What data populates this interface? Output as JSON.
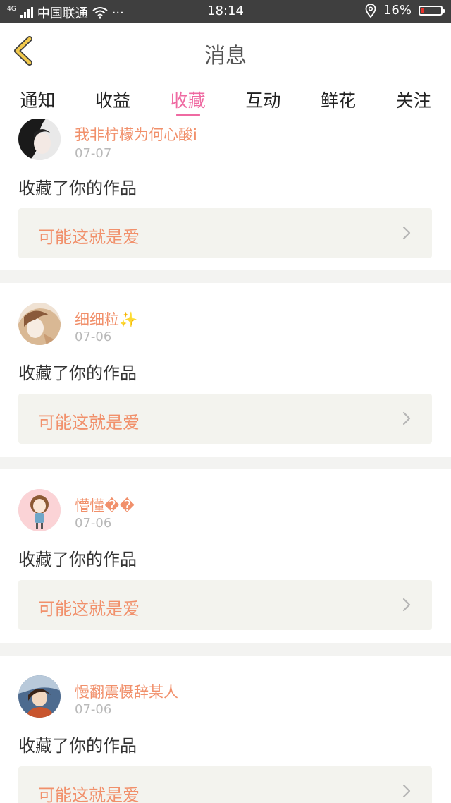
{
  "status_bar": {
    "network": "4G",
    "carrier": "中国联通",
    "dots": "···",
    "time": "18:14",
    "battery": "16%",
    "battery_level": 0.16
  },
  "header": {
    "title": "消息"
  },
  "tabs": [
    {
      "label": "通知"
    },
    {
      "label": "收益"
    },
    {
      "label": "收藏",
      "active": true
    },
    {
      "label": "互动"
    },
    {
      "label": "鲜花"
    },
    {
      "label": "关注"
    }
  ],
  "items": [
    {
      "user": "我非柠檬为何心酸i",
      "date": "07-07",
      "action": "收藏了你的作品",
      "work_title": "可能这就是爱"
    },
    {
      "user": "细细粒✨",
      "date": "07-06",
      "action": "收藏了你的作品",
      "work_title": "可能这就是爱"
    },
    {
      "user": "懵懂��",
      "date": "07-06",
      "action": "收藏了你的作品",
      "work_title": "可能这就是爱"
    },
    {
      "user": "慢翻震慑辞某人",
      "date": "07-06",
      "action": "收藏了你的作品",
      "work_title": "可能这就是爱"
    }
  ],
  "colors": {
    "accent_pink": "#ef6aa2",
    "name_orange": "#f1906b",
    "back_yellow": "#f2c94c"
  }
}
